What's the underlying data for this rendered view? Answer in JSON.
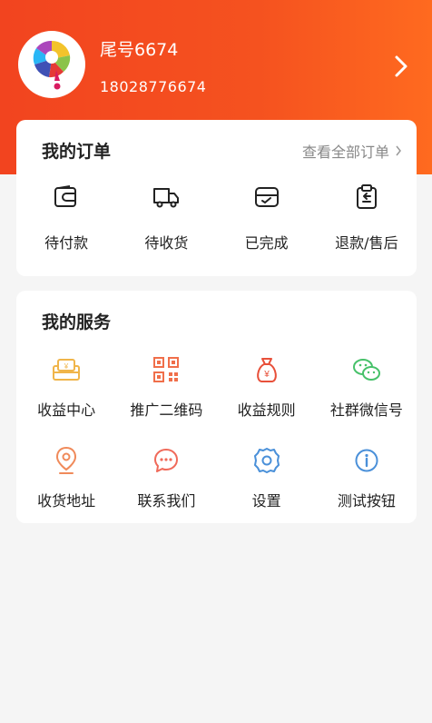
{
  "user": {
    "name": "尾号6674",
    "phone": "18028776674"
  },
  "orders": {
    "title": "我的订单",
    "view_all": "查看全部订单",
    "items": [
      {
        "label": "待付款",
        "icon": "wallet-icon"
      },
      {
        "label": "待收货",
        "icon": "truck-icon"
      },
      {
        "label": "已完成",
        "icon": "inbox-check-icon"
      },
      {
        "label": "退款/售后",
        "icon": "clipboard-return-icon"
      }
    ]
  },
  "services": {
    "title": "我的服务",
    "items": [
      {
        "label": "收益中心",
        "icon": "earnings-box-icon",
        "color": "#f0b54a"
      },
      {
        "label": "推广二维码",
        "icon": "qr-code-icon",
        "color": "#f06f4a"
      },
      {
        "label": "收益规则",
        "icon": "money-bag-icon",
        "color": "#e8503a"
      },
      {
        "label": "社群微信号",
        "icon": "wechat-icon",
        "color": "#47c16a"
      },
      {
        "label": "收货地址",
        "icon": "location-pin-icon",
        "color": "#f08a5a"
      },
      {
        "label": "联系我们",
        "icon": "chat-bubble-icon",
        "color": "#f06a5a"
      },
      {
        "label": "设置",
        "icon": "gear-icon",
        "color": "#4a90d9"
      },
      {
        "label": "测试按钮",
        "icon": "info-icon",
        "color": "#4a90d9"
      }
    ]
  },
  "colors": {
    "header": "#f2441f",
    "background": "#f5f5f5"
  }
}
